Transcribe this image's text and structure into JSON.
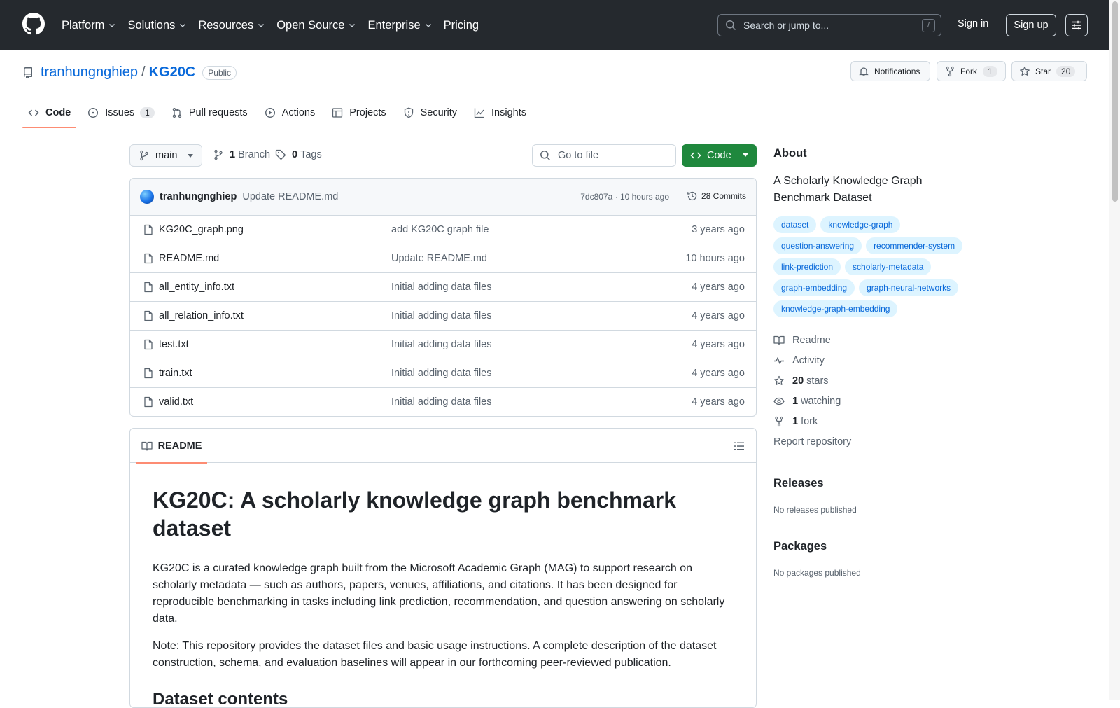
{
  "header": {
    "nav": [
      "Platform",
      "Solutions",
      "Resources",
      "Open Source",
      "Enterprise",
      "Pricing"
    ],
    "search_placeholder": "Search or jump to...",
    "search_shortcut": "/",
    "signin": "Sign in",
    "signup": "Sign up"
  },
  "repo": {
    "owner": "tranhungnghiep",
    "separator": "/",
    "name": "KG20C",
    "visibility": "Public",
    "notifications_label": "Notifications",
    "fork_label": "Fork",
    "fork_count": "1",
    "star_label": "Star",
    "star_count": "20"
  },
  "tabs": [
    {
      "label": "Code",
      "icon": "code-icon",
      "active": true
    },
    {
      "label": "Issues",
      "icon": "issue-icon",
      "count": "1"
    },
    {
      "label": "Pull requests",
      "icon": "pull-request-icon"
    },
    {
      "label": "Actions",
      "icon": "play-icon"
    },
    {
      "label": "Projects",
      "icon": "table-icon"
    },
    {
      "label": "Security",
      "icon": "shield-icon"
    },
    {
      "label": "Insights",
      "icon": "graph-icon"
    }
  ],
  "toolbar": {
    "branch": "main",
    "branch_count": "1",
    "branch_label": "Branch",
    "tag_count": "0",
    "tag_label": "Tags",
    "goto_placeholder": "Go to file",
    "code_button": "Code"
  },
  "last_commit": {
    "author": "tranhungnghiep",
    "message": "Update README.md",
    "meta": "7dc807a · 10 hours ago",
    "commits": "28 Commits"
  },
  "files": [
    {
      "name": "KG20C_graph.png",
      "message": "add KG20C graph file",
      "time": "3 years ago"
    },
    {
      "name": "README.md",
      "message": "Update README.md",
      "time": "10 hours ago"
    },
    {
      "name": "all_entity_info.txt",
      "message": "Initial adding data files",
      "time": "4 years ago"
    },
    {
      "name": "all_relation_info.txt",
      "message": "Initial adding data files",
      "time": "4 years ago"
    },
    {
      "name": "test.txt",
      "message": "Initial adding data files",
      "time": "4 years ago"
    },
    {
      "name": "train.txt",
      "message": "Initial adding data files",
      "time": "4 years ago"
    },
    {
      "name": "valid.txt",
      "message": "Initial adding data files",
      "time": "4 years ago"
    }
  ],
  "readme": {
    "tab_label": "README",
    "title": "KG20C: A scholarly knowledge graph benchmark dataset",
    "para1": "KG20C is a curated knowledge graph built from the Microsoft Academic Graph (MAG) to support research on scholarly metadata — such as authors, papers, venues, affiliations, and citations. It has been designed for reproducible benchmarking in tasks including link prediction, recommendation, and question answering on scholarly data.",
    "para2": "Note: This repository provides the dataset files and basic usage instructions. A complete description of the dataset construction, schema, and evaluation baselines will appear in our forthcoming peer-reviewed publication.",
    "section": "Dataset contents"
  },
  "about": {
    "heading": "About",
    "description": "A Scholarly Knowledge Graph Benchmark Dataset",
    "topics": [
      "dataset",
      "knowledge-graph",
      "question-answering",
      "recommender-system",
      "link-prediction",
      "scholarly-metadata",
      "graph-embedding",
      "graph-neural-networks",
      "knowledge-graph-embedding"
    ],
    "readme": "Readme",
    "activity": "Activity",
    "stars_count": "20",
    "stars_label": "stars",
    "watching_count": "1",
    "watching_label": "watching",
    "fork_count": "1",
    "fork_label": "fork",
    "report": "Report repository"
  },
  "releases": {
    "heading": "Releases",
    "text": "No releases published"
  },
  "packages": {
    "heading": "Packages",
    "text": "No packages published"
  },
  "colors": {
    "header_bg": "#25292e",
    "link": "#0969da",
    "primary_green": "#1f883d",
    "active_tab": "#fd8c73",
    "topic_bg": "#ddf4ff"
  }
}
